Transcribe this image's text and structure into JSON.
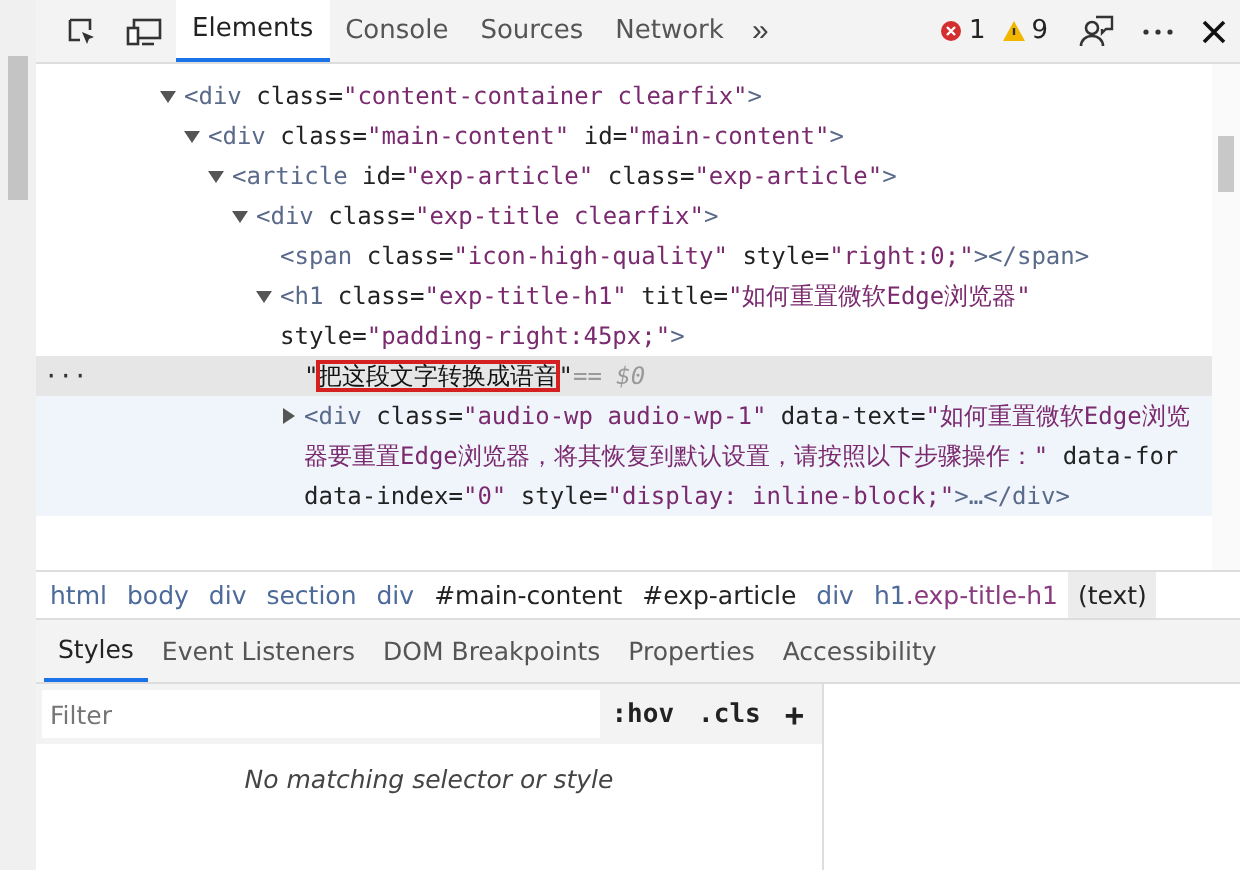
{
  "toolbar": {
    "tabs": [
      {
        "label": "Elements",
        "selected": true
      },
      {
        "label": "Console",
        "selected": false
      },
      {
        "label": "Sources",
        "selected": false
      },
      {
        "label": "Network",
        "selected": false
      }
    ],
    "more": "»",
    "errors": "1",
    "warnings": "9"
  },
  "dom_tree": [
    {
      "expanded": true,
      "selected": false,
      "hovered": false,
      "tokens": [
        {
          "kind": "tag",
          "text": "<div"
        },
        {
          "kind": "attr",
          "text": " class="
        },
        {
          "kind": "value",
          "text": "\"content-container clearfix\""
        },
        {
          "kind": "tag",
          "text": ">"
        }
      ],
      "children": [
        {
          "expanded": true,
          "selected": false,
          "hovered": false,
          "tokens": [
            {
              "kind": "tag",
              "text": "<div"
            },
            {
              "kind": "attr",
              "text": " class="
            },
            {
              "kind": "value",
              "text": "\"main-content\""
            },
            {
              "kind": "attr",
              "text": " id="
            },
            {
              "kind": "value",
              "text": "\"main-content\""
            },
            {
              "kind": "tag",
              "text": ">"
            }
          ],
          "children": [
            {
              "expanded": true,
              "selected": false,
              "hovered": false,
              "tokens": [
                {
                  "kind": "tag",
                  "text": "<article"
                },
                {
                  "kind": "attr",
                  "text": " id="
                },
                {
                  "kind": "value",
                  "text": "\"exp-article\""
                },
                {
                  "kind": "attr",
                  "text": " class="
                },
                {
                  "kind": "value",
                  "text": "\"exp-article\""
                },
                {
                  "kind": "tag",
                  "text": ">"
                }
              ],
              "children": [
                {
                  "expanded": true,
                  "selected": false,
                  "hovered": false,
                  "tokens": [
                    {
                      "kind": "tag",
                      "text": "<div"
                    },
                    {
                      "kind": "attr",
                      "text": " class="
                    },
                    {
                      "kind": "value",
                      "text": "\"exp-title clearfix\""
                    },
                    {
                      "kind": "tag",
                      "text": ">"
                    }
                  ],
                  "children": [
                    {
                      "selected": false,
                      "hovered": false,
                      "tokens": [
                        {
                          "kind": "tag",
                          "text": "<span"
                        },
                        {
                          "kind": "attr",
                          "text": " class="
                        },
                        {
                          "kind": "value",
                          "text": "\"icon-high-quality\""
                        },
                        {
                          "kind": "attr",
                          "text": " style="
                        },
                        {
                          "kind": "value",
                          "text": "\"right:0;\""
                        },
                        {
                          "kind": "tag",
                          "text": "></span>"
                        }
                      ]
                    },
                    {
                      "expanded": true,
                      "selected": false,
                      "hovered": false,
                      "tokens": [
                        {
                          "kind": "tag",
                          "text": "<h1"
                        },
                        {
                          "kind": "attr",
                          "text": " class="
                        },
                        {
                          "kind": "value",
                          "text": "\"exp-title-h1\""
                        },
                        {
                          "kind": "attr",
                          "text": " title="
                        },
                        {
                          "kind": "value",
                          "text": "\"如何重置微软Edge浏览器\""
                        },
                        {
                          "kind": "attr",
                          "text": " style="
                        },
                        {
                          "kind": "value",
                          "text": "\"padding-right:45px;\""
                        },
                        {
                          "kind": "tag",
                          "text": ">"
                        }
                      ],
                      "children": [
                        {
                          "selected": true,
                          "hovered": false,
                          "gutter": "···",
                          "suffix": "== $0",
                          "tokens": [
                            {
                              "kind": "text",
                              "text": "\""
                            },
                            {
                              "kind": "boxed",
                              "text": "把这段文字转换成语音"
                            },
                            {
                              "kind": "text",
                              "text": "\""
                            }
                          ]
                        },
                        {
                          "expanded": false,
                          "selected": false,
                          "hovered": true,
                          "tokens": [
                            {
                              "kind": "tag",
                              "text": "<div"
                            },
                            {
                              "kind": "attr",
                              "text": " class="
                            },
                            {
                              "kind": "value",
                              "text": "\"audio-wp audio-wp-1\""
                            },
                            {
                              "kind": "attr",
                              "text": " data-text="
                            },
                            {
                              "kind": "value",
                              "text": "\"如何重置微软Edge浏览器要重置Edge浏览器，将其恢复到默认设置，请按照以下步骤操作：\""
                            },
                            {
                              "kind": "attr",
                              "text": " data-for data-index="
                            },
                            {
                              "kind": "value",
                              "text": "\"0\""
                            },
                            {
                              "kind": "attr",
                              "text": " style="
                            },
                            {
                              "kind": "value",
                              "text": "\"display: inline-block;\""
                            },
                            {
                              "kind": "tag",
                              "text": ">…</div>"
                            }
                          ]
                        }
                      ]
                    }
                  ]
                }
              ]
            }
          ]
        }
      ]
    }
  ],
  "breadcrumbs": [
    {
      "selected": false,
      "parts": [
        {
          "kind": "tag",
          "text": "html"
        }
      ]
    },
    {
      "selected": false,
      "parts": [
        {
          "kind": "tag",
          "text": "body"
        }
      ]
    },
    {
      "selected": false,
      "parts": [
        {
          "kind": "tag",
          "text": "div"
        }
      ]
    },
    {
      "selected": false,
      "parts": [
        {
          "kind": "tag",
          "text": "section"
        }
      ]
    },
    {
      "selected": false,
      "parts": [
        {
          "kind": "tag",
          "text": "div"
        }
      ]
    },
    {
      "selected": false,
      "parts": [
        {
          "kind": "id",
          "text": "#main-content"
        }
      ]
    },
    {
      "selected": false,
      "parts": [
        {
          "kind": "id",
          "text": "#exp-article"
        }
      ]
    },
    {
      "selected": false,
      "parts": [
        {
          "kind": "tag",
          "text": "div"
        }
      ]
    },
    {
      "selected": false,
      "parts": [
        {
          "kind": "tag",
          "text": "h1"
        },
        {
          "kind": "class",
          "text": ".exp-title-h1"
        }
      ]
    },
    {
      "selected": true,
      "parts": [
        {
          "kind": "id",
          "text": "(text)"
        }
      ]
    }
  ],
  "sub_tabs": [
    {
      "label": "Styles",
      "selected": true
    },
    {
      "label": "Event Listeners",
      "selected": false
    },
    {
      "label": "DOM Breakpoints",
      "selected": false
    },
    {
      "label": "Properties",
      "selected": false
    },
    {
      "label": "Accessibility",
      "selected": false
    }
  ],
  "styles": {
    "filter_placeholder": "Filter",
    "hov": ":hov",
    "cls": ".cls",
    "add": "+",
    "empty_message": "No matching selector or style"
  }
}
